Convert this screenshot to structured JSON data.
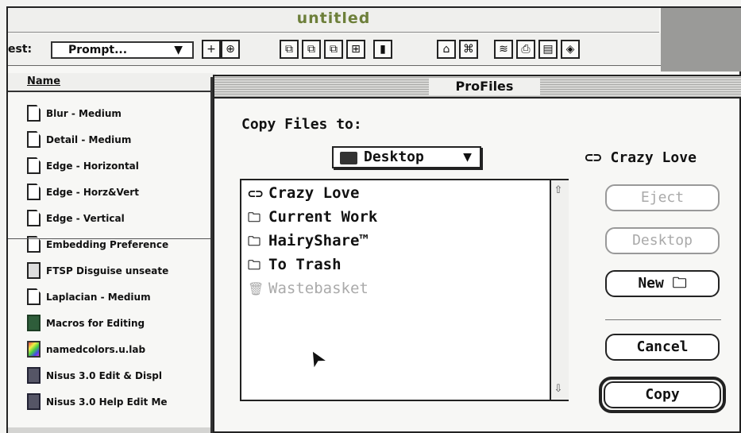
{
  "window": {
    "title": "untitled"
  },
  "toolbar": {
    "test_label": "est:",
    "test_select_value": "Prompt...",
    "select_caret": "▼",
    "buttons": [
      {
        "icon": "new-doc-icon",
        "glyph": "+"
      },
      {
        "icon": "zoom-icon",
        "glyph": "⊕"
      },
      {
        "icon": "copy-icon",
        "glyph": "⧉"
      },
      {
        "icon": "paste-icon",
        "glyph": "⧉"
      },
      {
        "icon": "duplicate-icon",
        "glyph": "⧉"
      },
      {
        "icon": "grid-icon",
        "glyph": "⊞"
      },
      {
        "icon": "trash-icon",
        "glyph": "▮"
      },
      {
        "icon": "network-icon",
        "glyph": "⌂"
      },
      {
        "icon": "tree-icon",
        "glyph": "⌘"
      },
      {
        "icon": "stack-icon",
        "glyph": "≋"
      },
      {
        "icon": "print-icon",
        "glyph": "⎙"
      },
      {
        "icon": "folder-icon",
        "glyph": "▤"
      },
      {
        "icon": "info-icon",
        "glyph": "◈"
      }
    ]
  },
  "file_list": {
    "column_header": "Name",
    "items": [
      {
        "name": "Blur - Medium",
        "icon": "document-icon",
        "kind": "doc"
      },
      {
        "name": "Detail - Medium",
        "icon": "document-icon",
        "kind": "doc"
      },
      {
        "name": "Edge - Horizontal",
        "icon": "document-icon",
        "kind": "doc"
      },
      {
        "name": "Edge - Horz&Vert",
        "icon": "document-icon",
        "kind": "doc"
      },
      {
        "name": "Edge - Vertical",
        "icon": "document-icon",
        "kind": "doc"
      },
      {
        "name": "Embedding Preference",
        "icon": "document-icon",
        "kind": "doc"
      },
      {
        "name": "FTSP Disguise unseate",
        "icon": "disguise-doc-icon",
        "kind": "disg"
      },
      {
        "name": "Laplacian - Medium",
        "icon": "document-icon",
        "kind": "doc"
      },
      {
        "name": "Macros for Editing",
        "icon": "macro-app-icon",
        "kind": "app"
      },
      {
        "name": "namedcolors.u.lab",
        "icon": "color-lab-icon",
        "kind": "lab"
      },
      {
        "name": "Nisus 3.0 Edit & Displ",
        "icon": "nisus-icon",
        "kind": "nisus"
      },
      {
        "name": "Nisus 3.0 Help Edit Me",
        "icon": "nisus-icon",
        "kind": "nisus"
      }
    ]
  },
  "dialog": {
    "title": "ProFiles",
    "prompt": "Copy Files to:",
    "location_popup": "Desktop",
    "popup_arrow": "▼",
    "disk_name": "Crazy Love",
    "disk_glyph": "⊂⊃",
    "files": [
      {
        "name": "Crazy Love",
        "icon": "disk-icon",
        "glyph": "⊂⊃",
        "enabled": true
      },
      {
        "name": "Current Work",
        "icon": "folder-icon",
        "glyph": "🗀",
        "enabled": true
      },
      {
        "name": "HairyShare™",
        "icon": "folder-icon",
        "glyph": "🗀",
        "enabled": true
      },
      {
        "name": "To Trash",
        "icon": "folder-icon",
        "glyph": "🗀",
        "enabled": true
      },
      {
        "name": "Wastebasket",
        "icon": "trash-icon",
        "glyph": "🗑",
        "enabled": false
      }
    ],
    "scroll_up": "⇧",
    "scroll_down": "⇩",
    "buttons": {
      "eject": "Eject",
      "desktop": "Desktop",
      "new": "New",
      "new_glyph": "🗀",
      "cancel": "Cancel",
      "copy": "Copy"
    },
    "cursor_glyph": "➤"
  }
}
